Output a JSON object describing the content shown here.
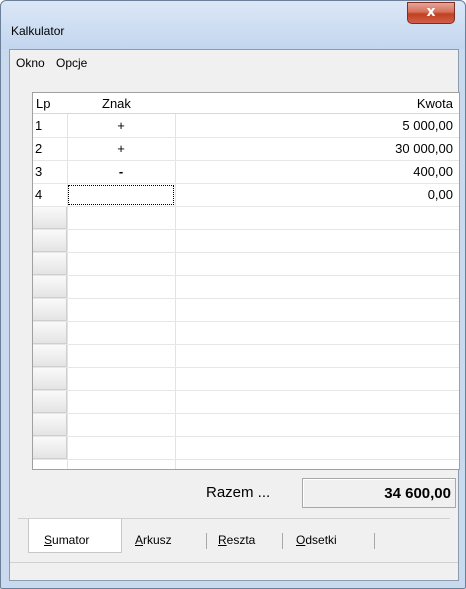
{
  "window": {
    "title": "Kalkulator",
    "close_label": "x"
  },
  "menu": [
    {
      "label": "Okno"
    },
    {
      "label": "Opcje"
    }
  ],
  "grid": {
    "columns": {
      "lp": "Lp",
      "sign": "Znak",
      "amount": "Kwota"
    },
    "rows": [
      {
        "lp": "1",
        "sign": "+",
        "amount": "5 000,00"
      },
      {
        "lp": "2",
        "sign": "+",
        "amount": "30 000,00"
      },
      {
        "lp": "3",
        "sign": "-",
        "amount": "400,00"
      },
      {
        "lp": "4",
        "sign": "",
        "amount": "0,00"
      }
    ]
  },
  "total": {
    "label": "Razem ...",
    "value": "34 600,00"
  },
  "tabs": [
    {
      "first": "S",
      "rest": "umator"
    },
    {
      "first": "A",
      "rest": "rkusz"
    },
    {
      "first": "R",
      "rest": "eszta"
    },
    {
      "first": "O",
      "rest": "dsetki"
    }
  ],
  "colors": {
    "titlebar": "#c9d9ee",
    "close_button": "#c2401f"
  }
}
